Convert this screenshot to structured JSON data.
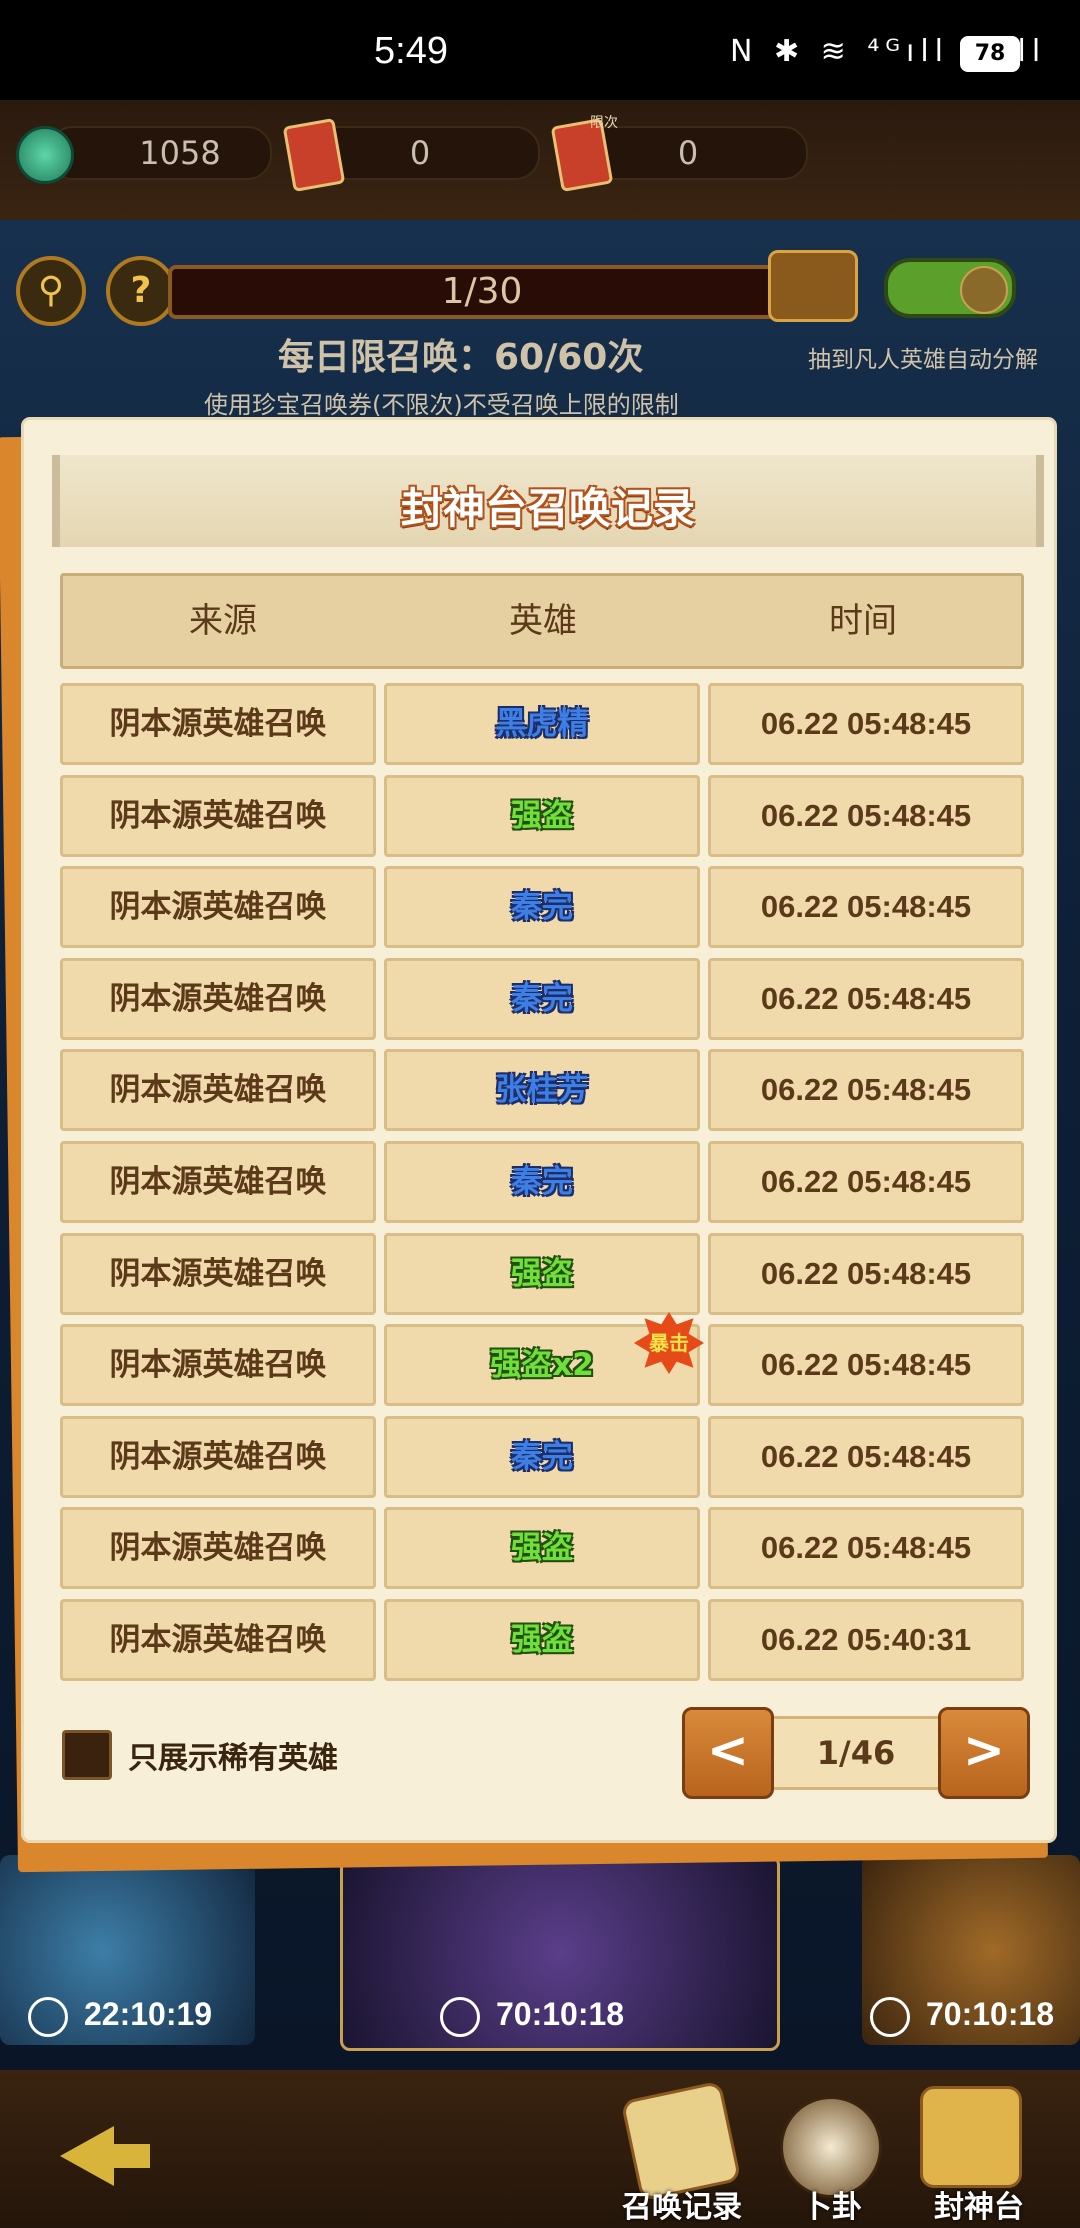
{
  "status_bar": {
    "time": "5:49",
    "icons": "N ✱ ≋ ⁴ᴳıll ⁴ᴳıll",
    "battery": "78"
  },
  "currencies": [
    {
      "icon": "jade-coin-icon",
      "value": "1058"
    },
    {
      "icon": "summon-ticket-icon",
      "value": "0"
    },
    {
      "icon": "limited-ticket-icon",
      "badge": "限次",
      "value": "0"
    }
  ],
  "summon_panel": {
    "progress": "1/30",
    "daily_limit": "每日限召唤：60/60次",
    "note": "使用珍宝召唤券(不限次)不受召唤上限的限制",
    "auto_decompose_label": "抽到凡人英雄自动分解"
  },
  "dialog": {
    "title": "封神台召唤记录",
    "columns": [
      "来源",
      "英雄",
      "时间"
    ],
    "crit_badge": "暴击",
    "rows": [
      {
        "source": "阴本源英雄召唤",
        "hero": "黑虎精",
        "time": "06.22 05:48:45"
      },
      {
        "source": "阴本源英雄召唤",
        "hero": "强盗",
        "time": "06.22 05:48:45"
      },
      {
        "source": "阴本源英雄召唤",
        "hero": "秦完",
        "time": "06.22 05:48:45"
      },
      {
        "source": "阴本源英雄召唤",
        "hero": "秦完",
        "time": "06.22 05:48:45"
      },
      {
        "source": "阴本源英雄召唤",
        "hero": "张桂芳",
        "time": "06.22 05:48:45"
      },
      {
        "source": "阴本源英雄召唤",
        "hero": "秦完",
        "time": "06.22 05:48:45"
      },
      {
        "source": "阴本源英雄召唤",
        "hero": "强盗",
        "time": "06.22 05:48:45"
      },
      {
        "source": "阴本源英雄召唤",
        "hero": "强盗x2",
        "time": "06.22 05:48:45"
      },
      {
        "source": "阴本源英雄召唤",
        "hero": "秦完",
        "time": "06.22 05:48:45"
      },
      {
        "source": "阴本源英雄召唤",
        "hero": "强盗",
        "time": "06.22 05:48:45"
      },
      {
        "source": "阴本源英雄召唤",
        "hero": "强盗",
        "time": "06.22 05:40:31"
      }
    ],
    "hero_colors": {
      "blue": "#3e7fe6",
      "green": "#6fe03a"
    },
    "rare_only_label": "只展示稀有英雄",
    "pagination": {
      "prev": "<",
      "page": "1/46",
      "next": ">"
    }
  },
  "summon_cards": [
    {
      "timer": "22:10:19"
    },
    {
      "timer": "70:10:18"
    },
    {
      "timer": "70:10:18"
    }
  ],
  "bottom_nav": {
    "record": "召唤记录",
    "divination": "卜卦",
    "altar": "封神台"
  }
}
